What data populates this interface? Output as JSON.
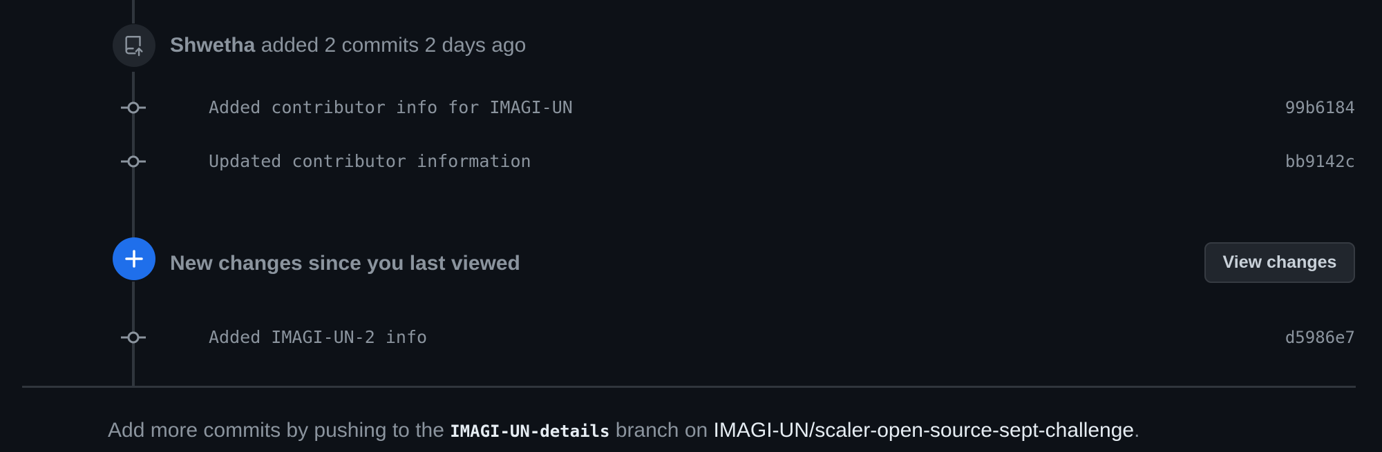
{
  "push_event": {
    "author": "Shwetha",
    "action": "added 2 commits",
    "time": "2 days ago",
    "icon": "repo-push-icon"
  },
  "commits_before": [
    {
      "message": "Added contributor info for IMAGI-UN",
      "sha": "99b6184"
    },
    {
      "message": "Updated contributor information",
      "sha": "bb9142c"
    }
  ],
  "new_changes": {
    "label": "New changes since you last viewed",
    "button_label": "View changes",
    "icon": "plus-icon",
    "accent_color": "#1f6feb"
  },
  "commits_after": [
    {
      "message": "Added IMAGI-UN-2 info",
      "sha": "d5986e7"
    }
  ],
  "footer": {
    "prefix": "Add more commits by pushing to the ",
    "branch": "IMAGI-UN-details",
    "middle": " branch on ",
    "repo": "IMAGI-UN/scaler-open-source-sept-challenge",
    "suffix": "."
  }
}
